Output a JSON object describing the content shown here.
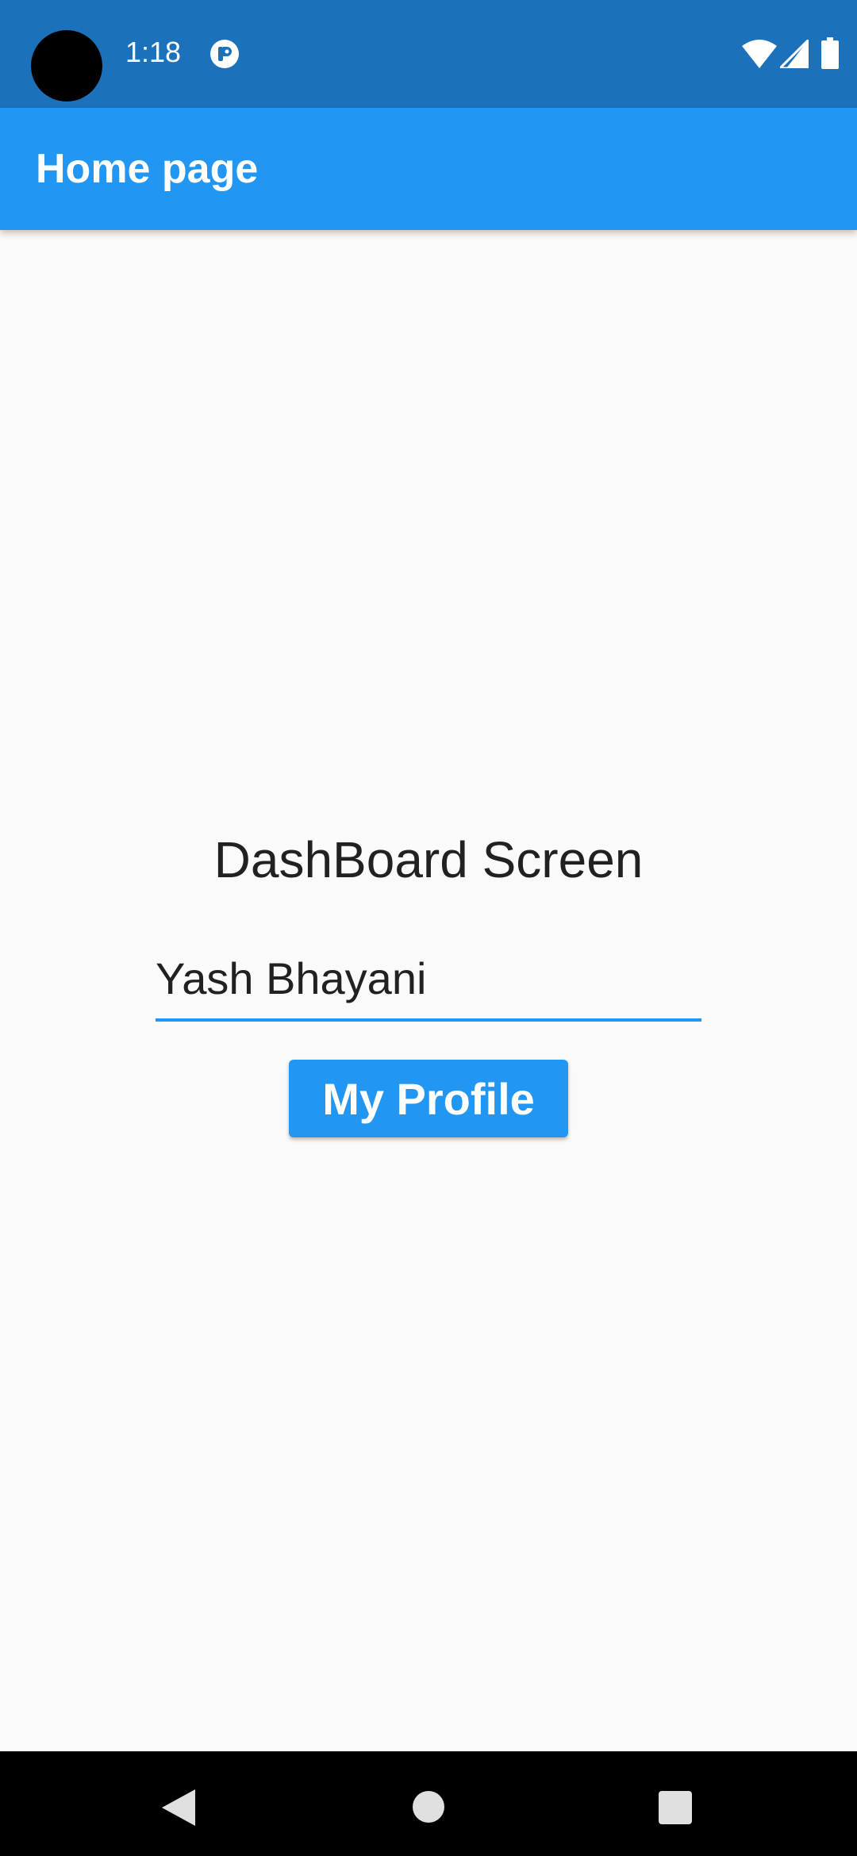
{
  "status_bar": {
    "time": "1:18",
    "background": "#1b72bb",
    "icons": [
      "notification-icon",
      "wifi-icon",
      "signal-icon",
      "battery-icon"
    ]
  },
  "app_bar": {
    "title": "Home page",
    "background": "#2196f3"
  },
  "main": {
    "heading": "DashBoard Screen",
    "name_field": {
      "value": "Yash Bhayani",
      "underline_color": "#2196f3"
    },
    "profile_button": {
      "label": "My Profile",
      "background": "#2196f3"
    }
  },
  "nav_bar": {
    "buttons": [
      "back-icon",
      "home-icon",
      "recents-icon"
    ]
  }
}
